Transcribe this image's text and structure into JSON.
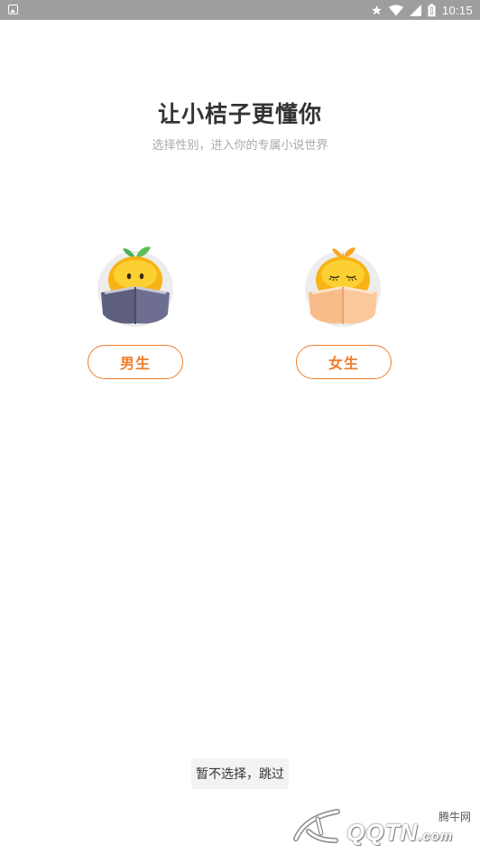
{
  "status_bar": {
    "time": "10:15",
    "icons": [
      "image-icon",
      "star-icon",
      "wifi-icon",
      "signal-icon",
      "battery-icon"
    ]
  },
  "header": {
    "title": "让小桔子更懂你",
    "subtitle": "选择性别，进入你的专属小说世界"
  },
  "gender_options": {
    "male_label": "男生",
    "female_label": "女生"
  },
  "skip": {
    "label": "暂不选择，跳过"
  },
  "watermark": {
    "cn_text": "腾牛网",
    "latin_text": "QQTN",
    "suffix": ".com"
  },
  "colors": {
    "accent": "#f07e2c",
    "status_bar": "#9e9e9e",
    "title": "#333333",
    "subtitle": "#aaaaaa"
  }
}
